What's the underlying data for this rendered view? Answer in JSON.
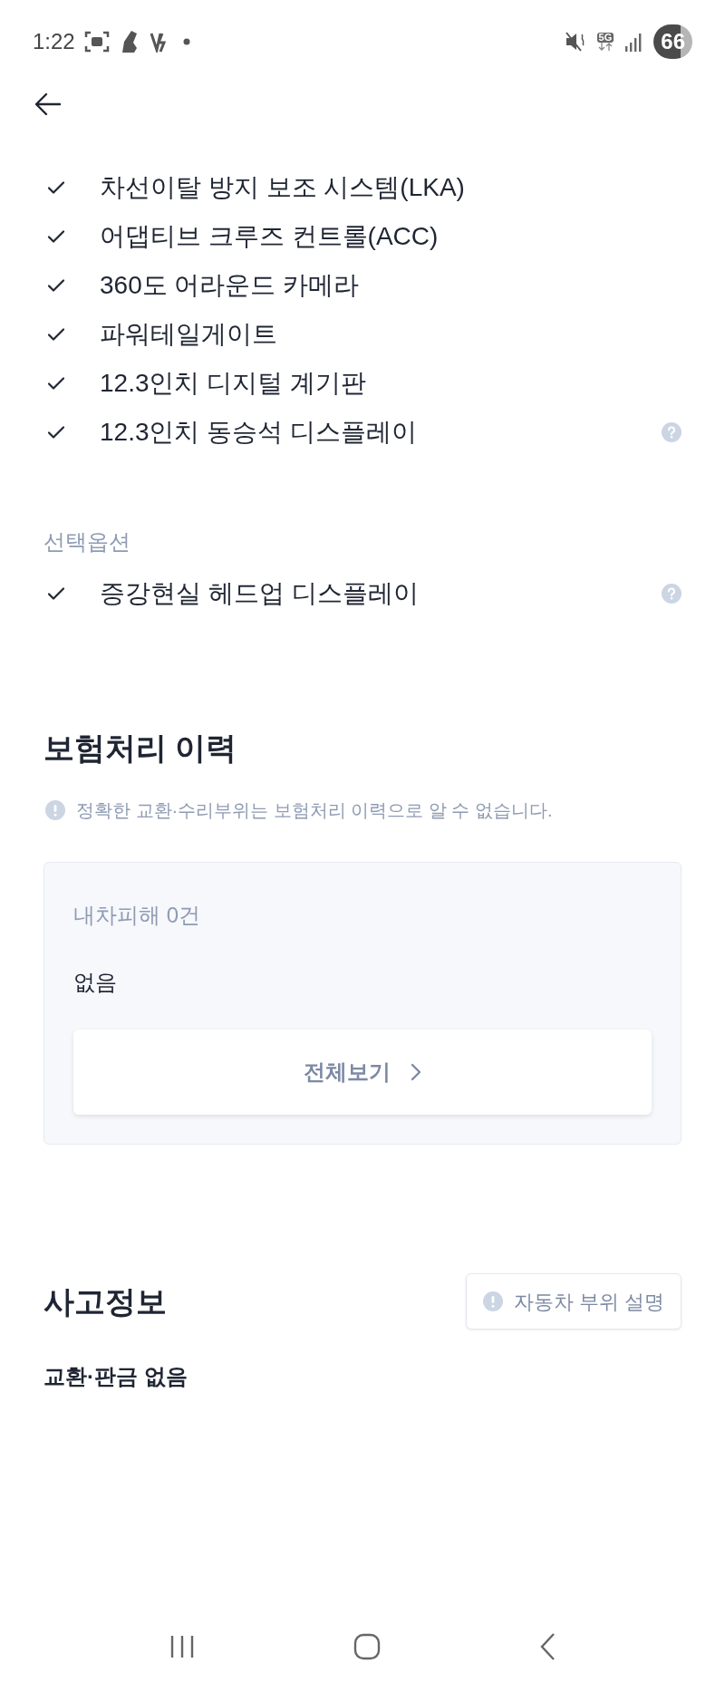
{
  "status_bar": {
    "time": "1:22",
    "network": "5G",
    "battery": "66"
  },
  "basic_options": [
    {
      "label": "차선이탈 방지 보조 시스템(LKA)",
      "checked": true,
      "help": false
    },
    {
      "label": "어댑티브 크루즈 컨트롤(ACC)",
      "checked": true,
      "help": false
    },
    {
      "label": "360도 어라운드 카메라",
      "checked": true,
      "help": false
    },
    {
      "label": "파워테일게이트",
      "checked": true,
      "help": false
    },
    {
      "label": "12.3인치 디지털 계기판",
      "checked": true,
      "help": false
    },
    {
      "label": "12.3인치 동승석 디스플레이",
      "checked": true,
      "help": true
    }
  ],
  "optional_section": {
    "title": "선택옵션",
    "items": [
      {
        "label": "증강현실 헤드업 디스플레이",
        "checked": true,
        "help": true
      }
    ]
  },
  "insurance": {
    "title": "보험처리 이력",
    "notice": "정확한 교환·수리부위는 보험처리 이력으로 알 수 없습니다.",
    "card": {
      "label": "내차피해 0건",
      "value": "없음",
      "button": "전체보기"
    }
  },
  "accident": {
    "title": "사고정보",
    "button": "자동차 부위 설명",
    "summary": "교환·판금 없음"
  }
}
